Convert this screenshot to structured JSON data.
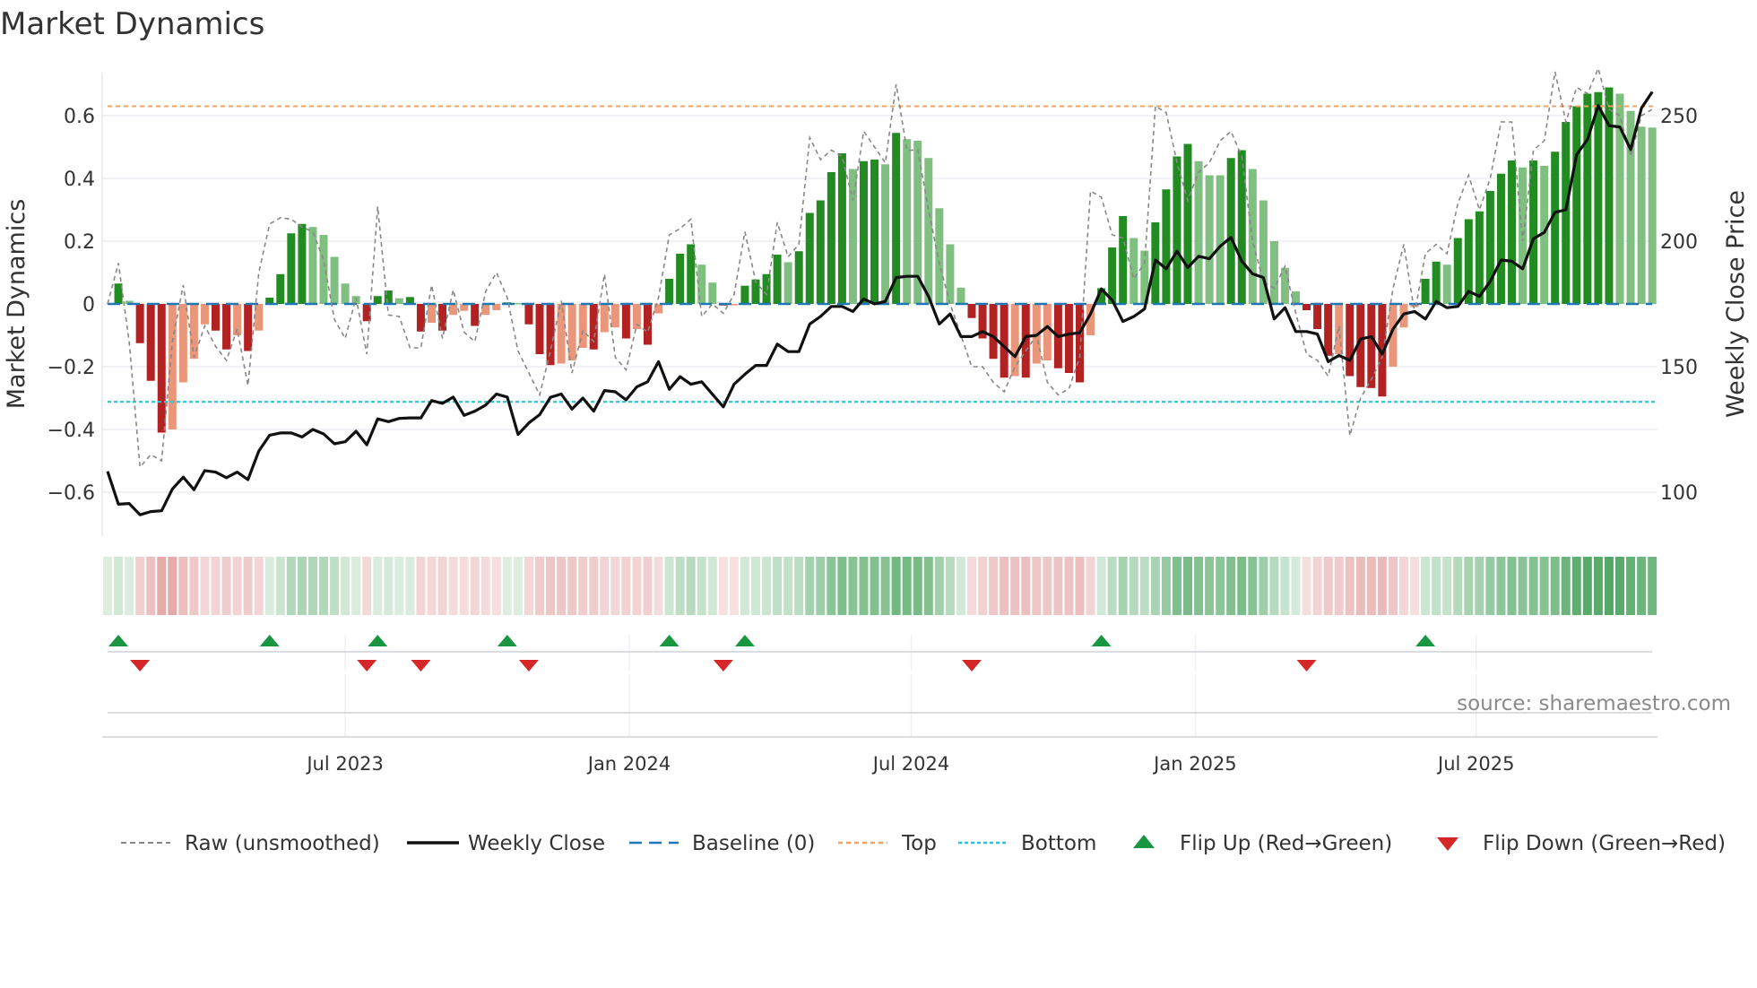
{
  "chart_data": {
    "type": "bar",
    "title": "Market Dynamics",
    "ylabel_left": "Market Dynamics",
    "ylabel_right": "Weekly Close Price",
    "ylim_left": [
      -0.74,
      0.74
    ],
    "ylim_right": [
      82.5,
      267.5
    ],
    "grid": true,
    "yticks_left": [
      {
        "v": -0.6,
        "label": "−0.6"
      },
      {
        "v": -0.4,
        "label": "−0.4"
      },
      {
        "v": -0.2,
        "label": "−0.2"
      },
      {
        "v": 0,
        "label": "0"
      },
      {
        "v": 0.2,
        "label": "0.2"
      },
      {
        "v": 0.4,
        "label": "0.4"
      },
      {
        "v": 0.6,
        "label": "0.6"
      }
    ],
    "yticks_right": [
      {
        "v": 100,
        "label": "100"
      },
      {
        "v": 150,
        "label": "150"
      },
      {
        "v": 200,
        "label": "200"
      },
      {
        "v": 250,
        "label": "250"
      }
    ],
    "x_unit": "week index",
    "x_ticks": [
      {
        "label": "Jul 2023",
        "week": 22.0
      },
      {
        "label": "Jan 2024",
        "week": 48.3
      },
      {
        "label": "Jul 2024",
        "week": 74.4
      },
      {
        "label": "Jan 2025",
        "week": 100.7
      },
      {
        "label": "Jul 2025",
        "week": 126.7
      }
    ],
    "top_level": 0.63,
    "bottom_level": -0.312,
    "baseline": 0,
    "market_dynamics": [
      0,
      0.065,
      0.01,
      -0.125,
      -0.245,
      -0.41,
      -0.4,
      -0.25,
      -0.175,
      -0.065,
      -0.085,
      -0.145,
      -0.1,
      -0.15,
      -0.085,
      0.02,
      0.095,
      0.225,
      0.255,
      0.245,
      0.22,
      0.15,
      0.065,
      0.025,
      -0.055,
      0.025,
      0.043,
      0.018,
      0.022,
      -0.088,
      -0.06,
      -0.085,
      -0.035,
      -0.022,
      -0.07,
      -0.035,
      -0.02,
      0.005,
      0.003,
      -0.065,
      -0.16,
      -0.195,
      -0.19,
      -0.18,
      -0.14,
      -0.145,
      -0.09,
      -0.075,
      -0.11,
      -0.08,
      -0.13,
      -0.03,
      0.08,
      0.16,
      0.19,
      0.125,
      0.068,
      -0.005,
      -0.004,
      0.058,
      0.078,
      0.095,
      0.157,
      0.133,
      0.168,
      0.29,
      0.33,
      0.42,
      0.48,
      0.43,
      0.455,
      0.46,
      0.445,
      0.545,
      0.525,
      0.52,
      0.465,
      0.305,
      0.19,
      0.052,
      -0.045,
      -0.11,
      -0.175,
      -0.235,
      -0.23,
      -0.235,
      -0.19,
      -0.18,
      -0.205,
      -0.22,
      -0.25,
      -0.1,
      0.05,
      0.18,
      0.28,
      0.21,
      0.17,
      0.26,
      0.365,
      0.47,
      0.51,
      0.455,
      0.41,
      0.41,
      0.465,
      0.49,
      0.43,
      0.33,
      0.2,
      0.115,
      0.04,
      -0.02,
      -0.08,
      -0.165,
      -0.16,
      -0.23,
      -0.265,
      -0.268,
      -0.295,
      -0.2,
      -0.075,
      -0.01,
      0.08,
      0.135,
      0.125,
      0.21,
      0.27,
      0.295,
      0.36,
      0.415,
      0.457,
      0.435,
      0.457,
      0.44,
      0.485,
      0.58,
      0.63,
      0.67,
      0.675,
      0.69,
      0.67,
      0.615,
      0.565,
      0.562
    ],
    "raw_unsmoothed": [
      0,
      0.13,
      -0.12,
      -0.52,
      -0.48,
      -0.5,
      -0.12,
      0.06,
      -0.17,
      -0.07,
      -0.135,
      -0.18,
      -0.08,
      -0.26,
      0.1,
      0.255,
      0.275,
      0.27,
      0.245,
      0.23,
      0.14,
      -0.05,
      -0.11,
      0.02,
      -0.16,
      0.31,
      -0.035,
      -0.04,
      -0.14,
      -0.14,
      0.06,
      -0.11,
      0.045,
      -0.09,
      -0.12,
      0.04,
      0.1,
      0.02,
      -0.15,
      -0.22,
      -0.29,
      -0.15,
      0.01,
      -0.22,
      -0.085,
      -0.12,
      0.095,
      -0.17,
      -0.21,
      -0.065,
      -0.09,
      0.02,
      0.22,
      0.24,
      0.27,
      -0.04,
      0,
      -0.03,
      0.03,
      0.23,
      0.07,
      0.03,
      0.26,
      0.15,
      0.19,
      0.53,
      0.46,
      0.49,
      0.47,
      0.33,
      0.55,
      0.5,
      0.45,
      0.7,
      0.49,
      0.49,
      0.3,
      0.13,
      0,
      -0.1,
      -0.2,
      -0.2,
      -0.25,
      -0.28,
      -0.2,
      -0.15,
      -0.1,
      -0.25,
      -0.29,
      -0.27,
      -0.17,
      0.36,
      0.34,
      0.22,
      0.21,
      0.08,
      0.13,
      0.63,
      0.61,
      0.45,
      0.33,
      0.42,
      0.45,
      0.52,
      0.55,
      0.47,
      0.2,
      0.07,
      0.05,
      0.12,
      -0.03,
      -0.16,
      -0.18,
      -0.23,
      -0.07,
      -0.42,
      -0.3,
      -0.24,
      -0.17,
      0.05,
      0.19,
      -0.03,
      0.16,
      0.19,
      0.16,
      0.32,
      0.41,
      0.3,
      0.4,
      0.58,
      0.58,
      0.2,
      0.49,
      0.52,
      0.74,
      0.58,
      0.69,
      0.67,
      0.75,
      0.62,
      0.6,
      0.47,
      0.6,
      0.62
    ],
    "weekly_close": [
      108.3,
      95.2,
      95.5,
      91,
      92.3,
      92.6,
      101.3,
      106,
      101,
      108.6,
      108,
      105.8,
      108,
      105,
      116.4,
      122.7,
      123.6,
      123.6,
      122,
      125,
      123.2,
      119.3,
      120.1,
      124.3,
      118.9,
      129.2,
      128.1,
      129.4,
      129.6,
      129.6,
      136.5,
      135.4,
      137.9,
      130.6,
      132.3,
      134.7,
      139.1,
      137.9,
      123,
      127.6,
      130.9,
      137.8,
      139.1,
      133.1,
      137.5,
      132.3,
      140.5,
      140,
      136.8,
      142,
      144,
      152,
      141,
      146,
      143,
      144,
      139,
      134,
      143,
      147,
      150.5,
      150.5,
      159,
      156,
      156,
      167,
      170,
      174,
      174,
      172,
      177,
      175,
      176,
      185.5,
      186,
      186,
      178,
      167,
      171,
      162,
      162,
      164,
      162,
      158,
      154,
      162,
      162.5,
      166,
      162,
      163,
      163.5,
      171,
      181,
      176.5,
      168,
      170,
      173,
      192.5,
      189,
      196,
      189.5,
      194,
      193,
      198,
      201.5,
      192,
      187,
      185.5,
      169,
      173.5,
      164,
      164,
      163,
      152,
      154.5,
      152.5,
      161,
      162,
      155,
      165,
      171,
      172,
      169,
      176,
      173.5,
      174,
      180,
      178,
      184,
      192.5,
      192,
      189,
      201,
      203.5,
      211.5,
      212.5,
      234.5,
      240.5,
      254,
      246,
      245.5,
      236.5,
      253,
      259.5
    ],
    "flips_up_weeks": [
      1,
      15,
      25,
      37,
      52,
      59,
      92,
      122
    ],
    "flips_down_weeks": [
      3,
      24,
      29,
      39,
      57,
      80,
      111
    ],
    "legend": {
      "raw": "Raw (unsmoothed)",
      "close": "Weekly Close",
      "baseline": "Baseline (0)",
      "top": "Top",
      "bottom": "Bottom",
      "flip_up": "Flip Up (Red→Green)",
      "flip_down": "Flip Down (Green→Red)"
    },
    "legend_placement": "bottom",
    "source": "source: sharemaestro.com",
    "colors": {
      "green_strong": "#228b22",
      "green_weak": "#7fbf7f",
      "red_strong": "#b22222",
      "red_weak": "#e9967a",
      "raw": "#888888",
      "close": "#111111",
      "baseline": "#1f77b4",
      "top": "#f4a460",
      "bottom": "#26c6da",
      "flip_up": "#1a9641",
      "flip_down": "#d62728"
    }
  }
}
